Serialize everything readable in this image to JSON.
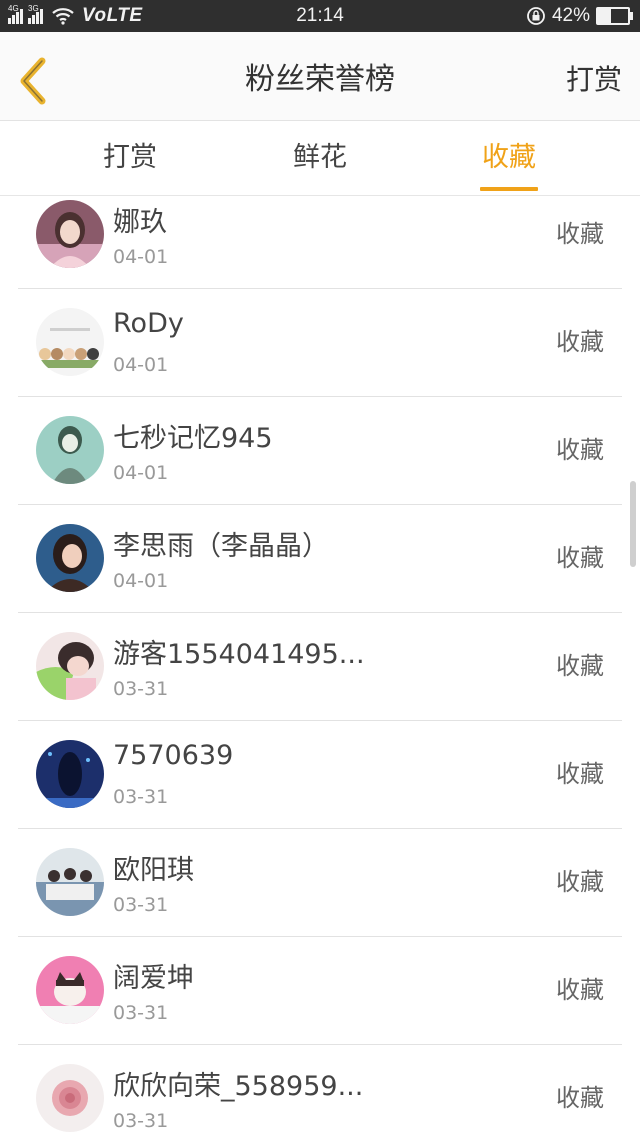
{
  "status_bar": {
    "net1": "4G",
    "net2": "3G",
    "volte": "VoLTE",
    "time": "21:14",
    "battery": "42%",
    "battery_level": 0.42
  },
  "header": {
    "title": "粉丝荣誉榜",
    "action": "打赏"
  },
  "tabs": [
    {
      "label": "打赏",
      "active": false
    },
    {
      "label": "鲜花",
      "active": false
    },
    {
      "label": "收藏",
      "active": true
    }
  ],
  "fans": [
    {
      "name": "娜玖",
      "date": "04-01",
      "action": "收藏"
    },
    {
      "name": "RoDy",
      "date": "04-01",
      "action": "收藏"
    },
    {
      "name": "七秒记忆945",
      "date": "04-01",
      "action": "收藏"
    },
    {
      "name": "李思雨（李晶晶）",
      "date": "04-01",
      "action": "收藏"
    },
    {
      "name": "游客1554041495...",
      "date": "03-31",
      "action": "收藏"
    },
    {
      "name": "7570639",
      "date": "03-31",
      "action": "收藏"
    },
    {
      "name": "欧阳琪",
      "date": "03-31",
      "action": "收藏"
    },
    {
      "name": "阔爱坤",
      "date": "03-31",
      "action": "收藏"
    },
    {
      "name": "欣欣向荣_558959...",
      "date": "03-31",
      "action": "收藏"
    }
  ],
  "colors": {
    "accent": "#f0a218",
    "status_bar_bg": "#2f2f2f"
  }
}
